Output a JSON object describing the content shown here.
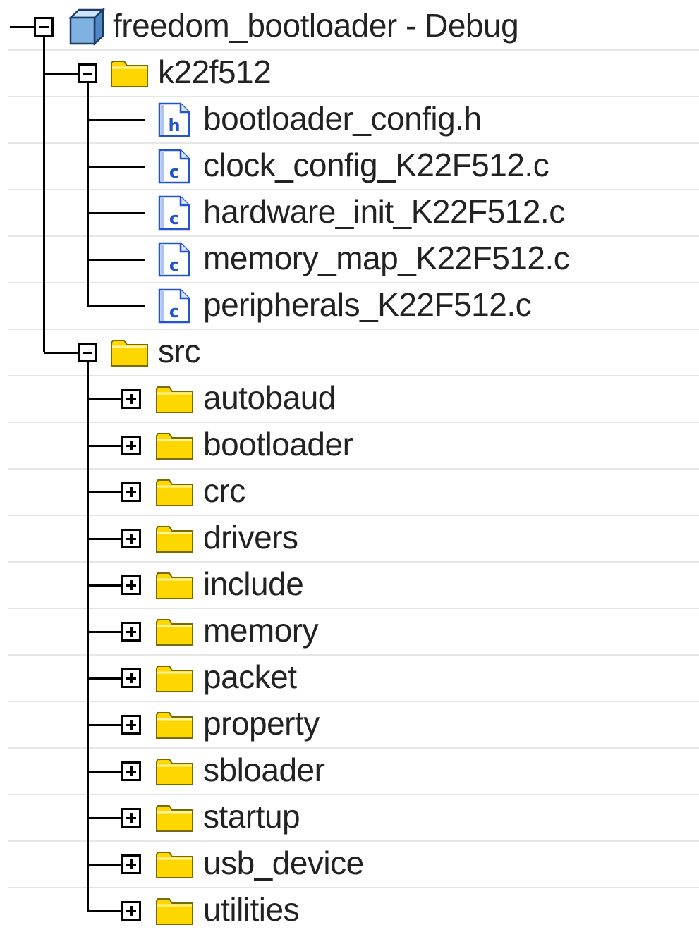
{
  "project": {
    "label": "freedom_bootloader - Debug",
    "icon": "project-cube-icon",
    "expanded": true
  },
  "tree": [
    {
      "name": "k22f512",
      "type": "folder",
      "expanded": true,
      "children": [
        {
          "name": "bootloader_config.h",
          "type": "header-file",
          "icon": "h-file-icon"
        },
        {
          "name": "clock_config_K22F512.c",
          "type": "c-file",
          "icon": "c-file-icon"
        },
        {
          "name": "hardware_init_K22F512.c",
          "type": "c-file",
          "icon": "c-file-icon"
        },
        {
          "name": "memory_map_K22F512.c",
          "type": "c-file",
          "icon": "c-file-icon"
        },
        {
          "name": "peripherals_K22F512.c",
          "type": "c-file",
          "icon": "c-file-icon"
        }
      ]
    },
    {
      "name": "src",
      "type": "folder",
      "expanded": true,
      "children": [
        {
          "name": "autobaud",
          "type": "folder",
          "expanded": false
        },
        {
          "name": "bootloader",
          "type": "folder",
          "expanded": false
        },
        {
          "name": "crc",
          "type": "folder",
          "expanded": false
        },
        {
          "name": "drivers",
          "type": "folder",
          "expanded": false
        },
        {
          "name": "include",
          "type": "folder",
          "expanded": false
        },
        {
          "name": "memory",
          "type": "folder",
          "expanded": false
        },
        {
          "name": "packet",
          "type": "folder",
          "expanded": false
        },
        {
          "name": "property",
          "type": "folder",
          "expanded": false
        },
        {
          "name": "sbloader",
          "type": "folder",
          "expanded": false
        },
        {
          "name": "startup",
          "type": "folder",
          "expanded": false
        },
        {
          "name": "usb_device",
          "type": "folder",
          "expanded": false
        },
        {
          "name": "utilities",
          "type": "folder",
          "expanded": false
        }
      ]
    }
  ],
  "colors": {
    "folder_fill": "#ffd700",
    "folder_stroke": "#7a6a00",
    "file_blue": "#2255cc",
    "cube_blue": "#7fb2e0",
    "text": "#222222",
    "row_separator": "#e6e6e6"
  }
}
